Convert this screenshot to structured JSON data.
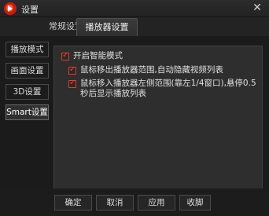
{
  "window": {
    "title": "设置",
    "close_glyph": "✕"
  },
  "tabs": [
    {
      "label": "常规设置",
      "selected": false
    },
    {
      "label": "播放器设置",
      "selected": true
    }
  ],
  "sidebar": {
    "items": [
      {
        "label": "播放模式",
        "selected": false
      },
      {
        "label": "画面设置",
        "selected": false
      },
      {
        "label": "3D设置",
        "selected": false
      },
      {
        "label": "Smart设置",
        "selected": true
      }
    ]
  },
  "options": [
    {
      "label": "开启智能模式",
      "checked": true
    },
    {
      "label": "鼠标移出播放器范围,自动隐藏视频列表",
      "checked": true
    },
    {
      "label": "鼠标移入播放器左侧范围(靠左1/4窗口),悬停0.5秒后显示播放列表",
      "checked": true
    }
  ],
  "footer": {
    "confirm": "确定",
    "cancel": "取消",
    "apply": "应用",
    "collapse": "收脚"
  }
}
